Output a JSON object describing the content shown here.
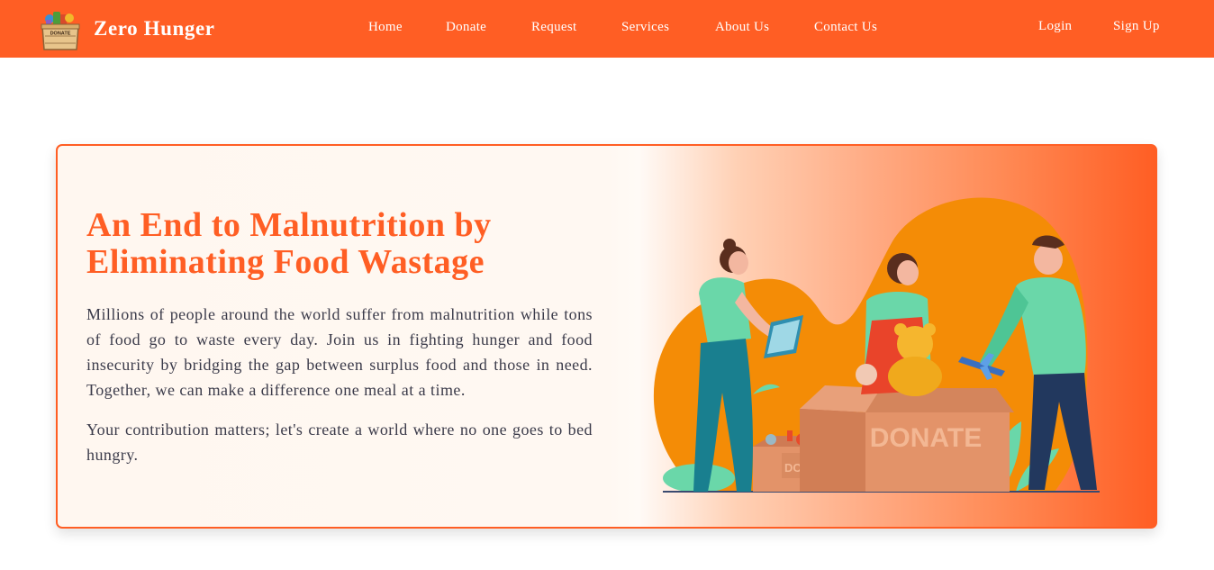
{
  "navbar": {
    "brand": {
      "name": "Zero Hunger",
      "logo_label": "DONATE"
    },
    "links": [
      {
        "label": "Home"
      },
      {
        "label": "Donate"
      },
      {
        "label": "Request"
      },
      {
        "label": "Services"
      },
      {
        "label": "About Us"
      },
      {
        "label": "Contact Us"
      }
    ],
    "auth": {
      "login": "Login",
      "signup": "Sign Up"
    }
  },
  "hero": {
    "title": "An End to Malnutrition by Eliminating Food Wastage",
    "paragraph1": "Millions of people around the world suffer from malnutrition while tons of food go to waste every day. Join us in fighting hunger and food insecurity by bridging the gap between surplus food and those in need. Together, we can make a difference one meal at a time.",
    "paragraph2": "Your contribution matters; let's create a world where no one goes to bed hungry.",
    "illustration": {
      "big_box_label": "DONATE",
      "small_box_label": "DONATE"
    }
  },
  "colors": {
    "brand_orange": "#ff5e24",
    "blob_orange": "#f48c06",
    "mint": "#6ad7a9",
    "teal": "#197f8f",
    "navy": "#22385e",
    "box": "#e39369",
    "text": "#3b3b4a"
  }
}
